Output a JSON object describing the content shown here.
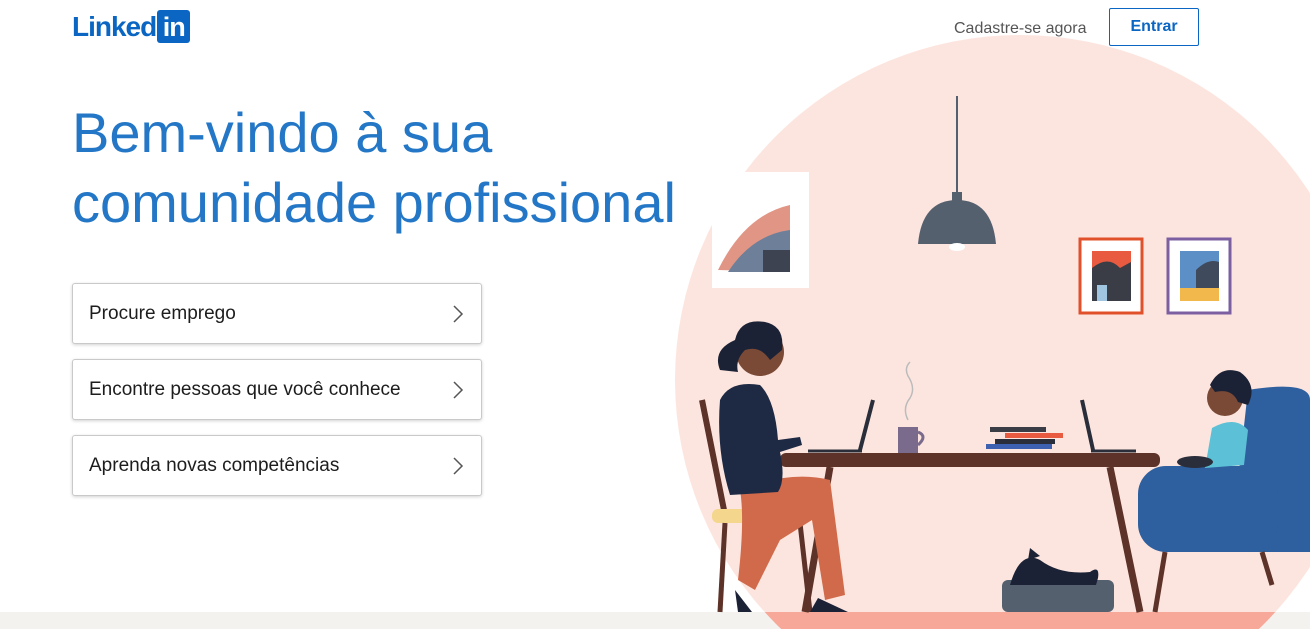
{
  "header": {
    "logo_word": "Linked",
    "logo_box": "in",
    "join_label": "Cadastre-se agora",
    "signin_label": "Entrar"
  },
  "main": {
    "headline": "Bem-vindo à sua comunidade profissional",
    "options": [
      {
        "label": "Procure emprego",
        "icon": "chevron-right-icon"
      },
      {
        "label": "Encontre pessoas que você conhece",
        "icon": "chevron-right-icon"
      },
      {
        "label": "Aprenda novas competências",
        "icon": "chevron-right-icon"
      }
    ]
  },
  "colors": {
    "brand": "#0a66c2",
    "headline": "#2377c6",
    "illustration_bg": "#fde5df"
  }
}
